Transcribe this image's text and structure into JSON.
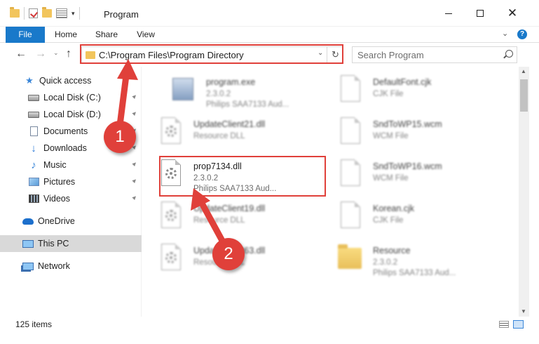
{
  "window": {
    "title": "Program",
    "minimize_glyph": "",
    "maximize_glyph": "",
    "close_glyph": "✕"
  },
  "ribbon": {
    "tabs": [
      "File",
      "Home",
      "Share",
      "View"
    ],
    "chevron_glyph": "⌄",
    "help_glyph": "?"
  },
  "nav": {
    "back_glyph": "←",
    "forward_glyph": "→",
    "recent_glyph": "⌄",
    "up_glyph": "↑",
    "address": "C:\\Program Files\\Program Directory",
    "dropdown_glyph": "⌄",
    "refresh_glyph": "↻",
    "search_placeholder": "Search Program"
  },
  "sidebar": {
    "items": [
      {
        "label": "Quick access",
        "icon": "star-icon",
        "pinned": false
      },
      {
        "label": "Local Disk (C:)",
        "icon": "drive-icon",
        "pinned": true
      },
      {
        "label": "Local Disk (D:)",
        "icon": "drive-icon",
        "pinned": true
      },
      {
        "label": "Documents",
        "icon": "documents-icon",
        "pinned": true
      },
      {
        "label": "Downloads",
        "icon": "download-icon",
        "pinned": true
      },
      {
        "label": "Music",
        "icon": "music-icon",
        "pinned": true
      },
      {
        "label": "Pictures",
        "icon": "pictures-icon",
        "pinned": true
      },
      {
        "label": "Videos",
        "icon": "videos-icon",
        "pinned": true
      },
      {
        "label": "OneDrive",
        "icon": "cloud-icon",
        "pinned": false
      },
      {
        "label": "This PC",
        "icon": "computer-icon",
        "pinned": false,
        "selected": true
      },
      {
        "label": "Network",
        "icon": "network-icon",
        "pinned": false
      }
    ],
    "pin_glyph": "📌"
  },
  "files": [
    {
      "name": "program.exe",
      "line2": "2.3.0.2",
      "line3": "Philips SAA7133 Aud...",
      "icon": "exe-icon"
    },
    {
      "name": "DefaultFont.cjk",
      "line2": "CJK File",
      "line3": "",
      "icon": "file-icon"
    },
    {
      "name": "UpdateClient21.dll",
      "line2": "Resource DLL",
      "line3": "",
      "icon": "dll-icon"
    },
    {
      "name": "SndToWP15.wcm",
      "line2": "WCM File",
      "line3": "",
      "icon": "file-icon"
    },
    {
      "name": "prop7134.dll",
      "line2": "2.3.0.2",
      "line3": "Philips SAA7133 Aud...",
      "icon": "dll-icon"
    },
    {
      "name": "SndToWP16.wcm",
      "line2": "WCM File",
      "line3": "",
      "icon": "file-icon"
    },
    {
      "name": "UpdateClient19.dll",
      "line2": "Resource DLL",
      "line3": "",
      "icon": "dll-icon"
    },
    {
      "name": "Korean.cjk",
      "line2": "CJK File",
      "line3": "",
      "icon": "file-icon"
    },
    {
      "name": "UpdateClient63.dll",
      "line2": "Resource DLL",
      "line3": "",
      "icon": "dll-icon"
    },
    {
      "name": "Resource",
      "line2": "2.3.0.2",
      "line3": "Philips SAA7133 Aud...",
      "icon": "folder-icon"
    }
  ],
  "status": {
    "item_count": "125 items"
  },
  "annotations": {
    "step1": "1",
    "step2": "2",
    "color": "#e0403a"
  },
  "colors": {
    "accent": "#1979ca",
    "selected": "#d9d9d9"
  }
}
